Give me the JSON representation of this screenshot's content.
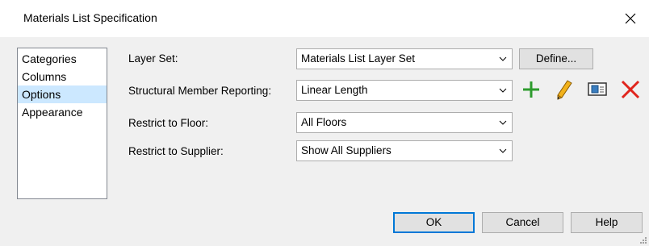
{
  "window": {
    "title": "Materials List Specification"
  },
  "nav": {
    "items": [
      {
        "label": "Categories"
      },
      {
        "label": "Columns"
      },
      {
        "label": "Options"
      },
      {
        "label": "Appearance"
      }
    ],
    "selected": "Options"
  },
  "fields": {
    "layer_set": {
      "label": "Layer Set:",
      "value": "Materials List Layer Set"
    },
    "structural": {
      "label": "Structural Member Reporting:",
      "value": "Linear Length"
    },
    "floor": {
      "label": "Restrict to Floor:",
      "value": "All Floors"
    },
    "supplier": {
      "label": "Restrict to Supplier:",
      "value": "Show All Suppliers"
    }
  },
  "buttons": {
    "define": "Define...",
    "ok": "OK",
    "cancel": "Cancel",
    "help": "Help"
  },
  "icons": {
    "add": "plus-icon",
    "edit": "pencil-icon",
    "library": "library-icon",
    "delete": "delete-x-icon",
    "close": "close-icon"
  },
  "colors": {
    "add": "#2e9b2e",
    "edit": "#f2b21b",
    "delete": "#e0241c",
    "selection": "#cce8ff",
    "default_button": "#0078d7"
  }
}
